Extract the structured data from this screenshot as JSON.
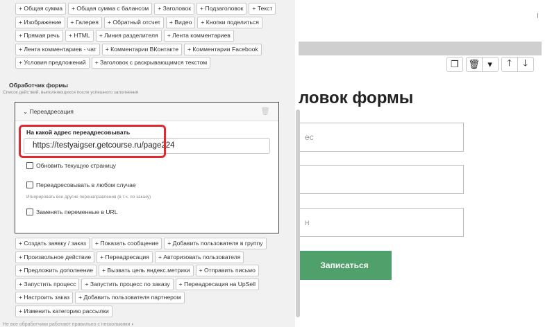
{
  "top_chips": [
    [
      "+ Общая сумма",
      "+ Общая сумма с балансом",
      "+ Заголовок",
      "+ Подзаголовок",
      "+ Текст"
    ],
    [
      "+ Изображение",
      "+ Галерея",
      "+ Обратный отсчет",
      "+ Видео",
      "+ Кнопки поделиться"
    ],
    [
      "+ Прямая речь",
      "+ HTML",
      "+ Линия разделителя",
      "+ Лента комментариев"
    ],
    [
      "+ Лента комментариев - чат",
      "+ Комментарии ВКонтакте",
      "+ Комментарии Facebook"
    ],
    [
      "+ Условия предложений",
      "+ Заголовок с раскрывающимся текстом"
    ]
  ],
  "handler": {
    "title": "Обработчик формы",
    "subtitle": "Список действий, выполняющихся после успешного заполнения"
  },
  "redirect": {
    "header": "Переадресация",
    "address_label": "На какой адрес переадресовывать",
    "address_value": "https://testyaigser.getcourse.ru/page224",
    "opt_refresh": "Обновить текущую страницу",
    "opt_always": "Переадресовывать в любом случае",
    "opt_always_hint": "Игнорировать все другие перенаправления (в т.ч. по заказу)",
    "opt_replace": "Заменять переменные в URL"
  },
  "action_chips": [
    [
      "+ Создать заявку / заказ",
      "+ Показать сообщение",
      "+ Добавить пользователя в группу"
    ],
    [
      "+ Произвольное действие",
      "+ Переадресация",
      "+ Авторизовать пользователя"
    ],
    [
      "+ Предложить дополнение",
      "+ Вызвать цель яндекс.метрики",
      "+ Отправить письмо"
    ],
    [
      "+ Запустить процесс",
      "+ Запустить процесс по заказу",
      "+ Переадресация на UpSell"
    ],
    [
      "+ Настроить заказ",
      "+ Добавить пользователя партнером"
    ],
    [
      "+ Изменить категорию рассылки"
    ]
  ],
  "footer_text": "Не все обработчики работают правильно с несколькими ◐",
  "page": {
    "form_title": "ловок формы",
    "field1_placeholder": "ес",
    "field3_placeholder": "н",
    "submit_label": "Записаться"
  },
  "toolbar_icons": [
    "copy-icon",
    "trash-icon",
    "caret-down-icon",
    "arrow-up-icon",
    "arrow-down-icon"
  ]
}
